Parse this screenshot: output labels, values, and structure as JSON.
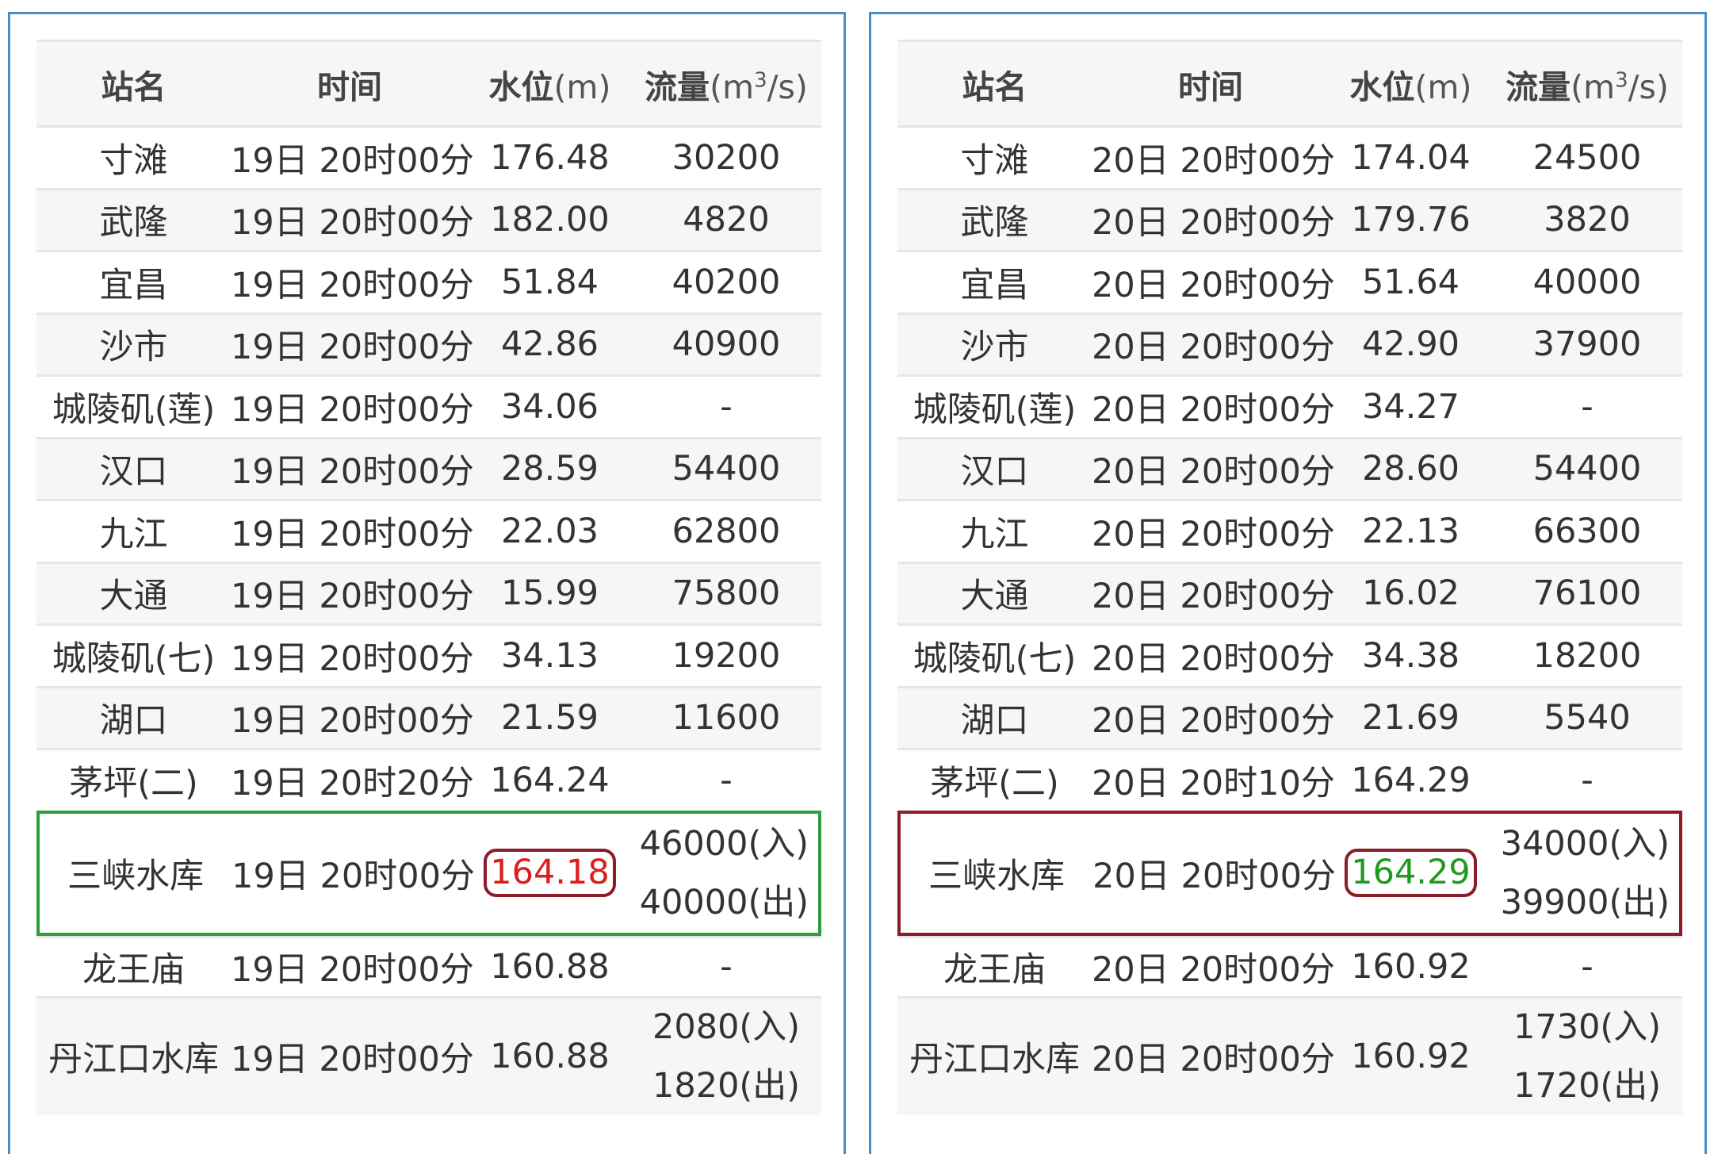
{
  "headers": {
    "station": "站名",
    "time": "时间",
    "level": "水位",
    "level_unit": "(m)",
    "flow": "流量",
    "flow_unit_pre": "(m",
    "flow_unit_sup": "3",
    "flow_unit_post": "/s)"
  },
  "colors": {
    "green": "#1f9a1f",
    "red": "#dd1c1c",
    "panel_border": "#4a8ec4",
    "highlight_green": "#2e9e3f",
    "highlight_maroon": "#8a1c2b"
  },
  "left": {
    "rows": [
      {
        "station": "寸滩",
        "time": "19日 20时00分",
        "level": "176.48",
        "level_color": "green",
        "flow": "30200"
      },
      {
        "station": "武隆",
        "time": "19日 20时00分",
        "level": "182.00",
        "level_color": "green",
        "flow": "4820"
      },
      {
        "station": "宜昌",
        "time": "19日 20时00分",
        "level": "51.84",
        "level_color": "red",
        "flow": "40200"
      },
      {
        "station": "沙市",
        "time": "19日 20时00分",
        "level": "42.86",
        "level_color": "red",
        "flow": "40900"
      },
      {
        "station": "城陵矶(莲)",
        "time": "19日 20时00分",
        "level": "34.06",
        "level_color": "red",
        "flow": "-"
      },
      {
        "station": "汉口",
        "time": "19日 20时00分",
        "level": "28.59",
        "level_color": "red",
        "flow": "54400"
      },
      {
        "station": "九江",
        "time": "19日 20时00分",
        "level": "22.03",
        "level_color": "gray",
        "flow": "62800"
      },
      {
        "station": "大通",
        "time": "19日 20时00分",
        "level": "15.99",
        "level_color": "gray",
        "flow": "75800"
      },
      {
        "station": "城陵矶(七)",
        "time": "19日 20时00分",
        "level": "34.13",
        "level_color": "gray",
        "flow": "19200"
      },
      {
        "station": "湖口",
        "time": "19日 20时00分",
        "level": "21.59",
        "level_color": "green",
        "flow": "11600"
      },
      {
        "station": "茅坪(二)",
        "time": "19日 20时20分",
        "level": "164.24",
        "level_color": "red",
        "flow": "-"
      }
    ],
    "sanxia": {
      "station": "三峡水库",
      "time": "19日 20时00分",
      "level": "164.18",
      "level_color": "red",
      "flow_in": "46000(入)",
      "flow_out": "40000(出)"
    },
    "longwang": {
      "station": "龙王庙",
      "time": "19日 20时00分",
      "level": "160.88",
      "level_color": "gray",
      "flow": "-"
    },
    "danjiang": {
      "station": "丹江口水库",
      "time": "19日 20时00分",
      "level": "160.88",
      "level_color": "gray",
      "flow_in": "2080(入)",
      "flow_out": "1820(出)"
    }
  },
  "right": {
    "rows": [
      {
        "station": "寸滩",
        "time": "20日 20时00分",
        "level": "174.04",
        "level_color": "green",
        "flow": "24500"
      },
      {
        "station": "武隆",
        "time": "20日 20时00分",
        "level": "179.76",
        "level_color": "red",
        "flow": "3820"
      },
      {
        "station": "宜昌",
        "time": "20日 20时00分",
        "level": "51.64",
        "level_color": "green",
        "flow": "40000"
      },
      {
        "station": "沙市",
        "time": "20日 20时00分",
        "level": "42.90",
        "level_color": "red",
        "flow": "37900"
      },
      {
        "station": "城陵矶(莲)",
        "time": "20日 20时00分",
        "level": "34.27",
        "level_color": "green",
        "flow": "-"
      },
      {
        "station": "汉口",
        "time": "20日 20时00分",
        "level": "28.60",
        "level_color": "green",
        "flow": "54400"
      },
      {
        "station": "九江",
        "time": "20日 20时00分",
        "level": "22.13",
        "level_color": "green",
        "flow": "66300"
      },
      {
        "station": "大通",
        "time": "20日 20时00分",
        "level": "16.02",
        "level_color": "gray",
        "flow": "76100"
      },
      {
        "station": "城陵矶(七)",
        "time": "20日 20时00分",
        "level": "34.38",
        "level_color": "green",
        "flow": "18200"
      },
      {
        "station": "湖口",
        "time": "20日 20时00分",
        "level": "21.69",
        "level_color": "green",
        "flow": "5540"
      },
      {
        "station": "茅坪(二)",
        "time": "20日 20时10分",
        "level": "164.29",
        "level_color": "red",
        "flow": "-"
      }
    ],
    "sanxia": {
      "station": "三峡水库",
      "time": "20日 20时00分",
      "level": "164.29",
      "level_color": "green",
      "flow_in": "34000(入)",
      "flow_out": "39900(出)"
    },
    "longwang": {
      "station": "龙王庙",
      "time": "20日 20时00分",
      "level": "160.92",
      "level_color": "red",
      "flow": "-"
    },
    "danjiang": {
      "station": "丹江口水库",
      "time": "20日 20时00分",
      "level": "160.92",
      "level_color": "red",
      "flow_in": "1730(入)",
      "flow_out": "1720(出)"
    }
  }
}
